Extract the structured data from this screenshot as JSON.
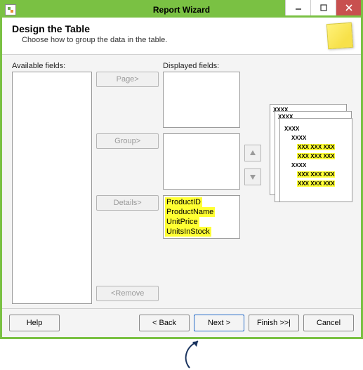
{
  "window": {
    "title": "Report Wizard"
  },
  "header": {
    "title": "Design the Table",
    "subtitle": "Choose how to group the data in the table."
  },
  "labels": {
    "available": "Available fields:",
    "displayed": "Displayed fields:"
  },
  "midButtons": {
    "page": "Page>",
    "group": "Group>",
    "details": "Details>",
    "remove": "<Remove"
  },
  "detailsFields": [
    "ProductID",
    "ProductName",
    "UnitPrice",
    "UnitsInStock"
  ],
  "preview": {
    "header": "XXXX",
    "sub": "XXXX",
    "row": "XXX XXX XXX"
  },
  "footer": {
    "help": "Help",
    "back": "< Back",
    "next": "Next >",
    "finish": "Finish >>|",
    "cancel": "Cancel"
  }
}
